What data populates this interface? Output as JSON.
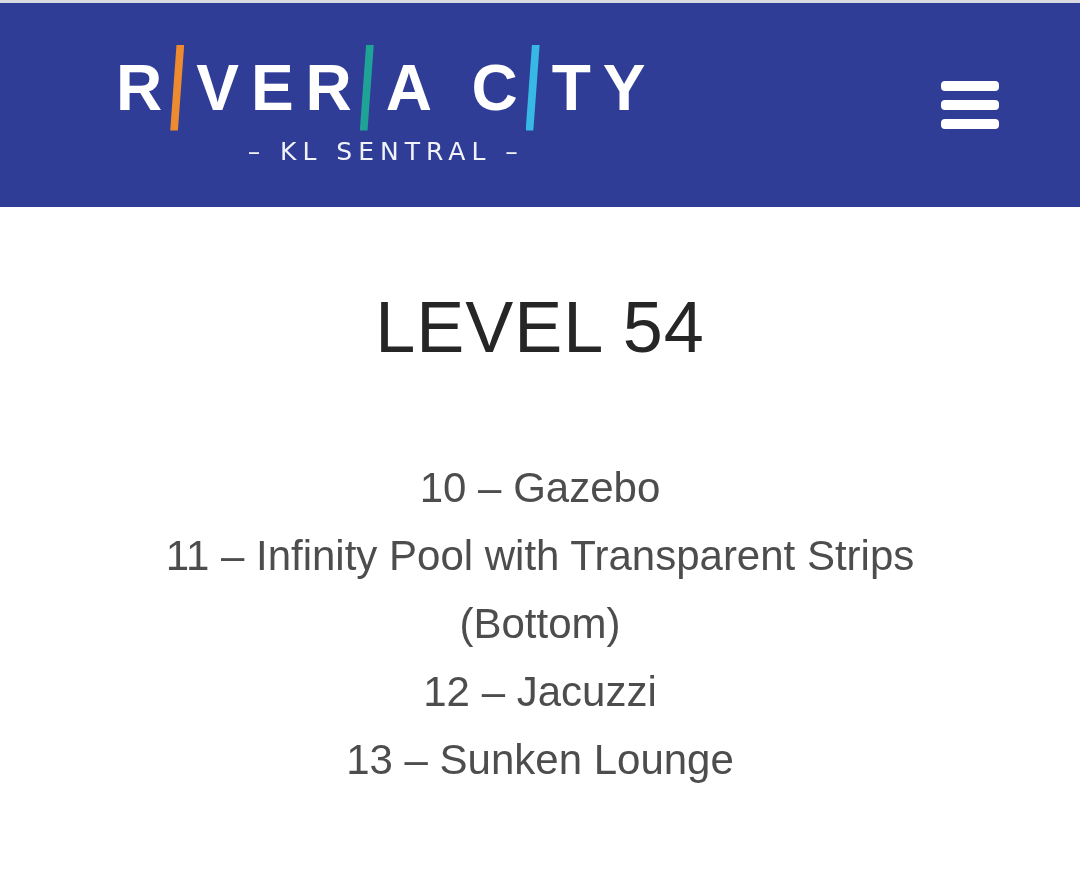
{
  "header": {
    "logo": {
      "parts": [
        {
          "kind": "letters",
          "text": "R"
        },
        {
          "kind": "bar",
          "color": "#ee8a30"
        },
        {
          "kind": "letters",
          "text": "VER"
        },
        {
          "kind": "bar",
          "color": "#1ea396"
        },
        {
          "kind": "letters",
          "text": "A C"
        },
        {
          "kind": "bar",
          "color": "#38b8e4"
        },
        {
          "kind": "letters",
          "text": "TY"
        }
      ],
      "tagline": "– KL SENTRAL –"
    }
  },
  "title": "LEVEL 54",
  "amenities": [
    "10 – Gazebo",
    "11 – Infinity Pool with Transparent Strips (Bottom)",
    "12 – Jacuzzi",
    "13 – Sunken Lounge"
  ]
}
